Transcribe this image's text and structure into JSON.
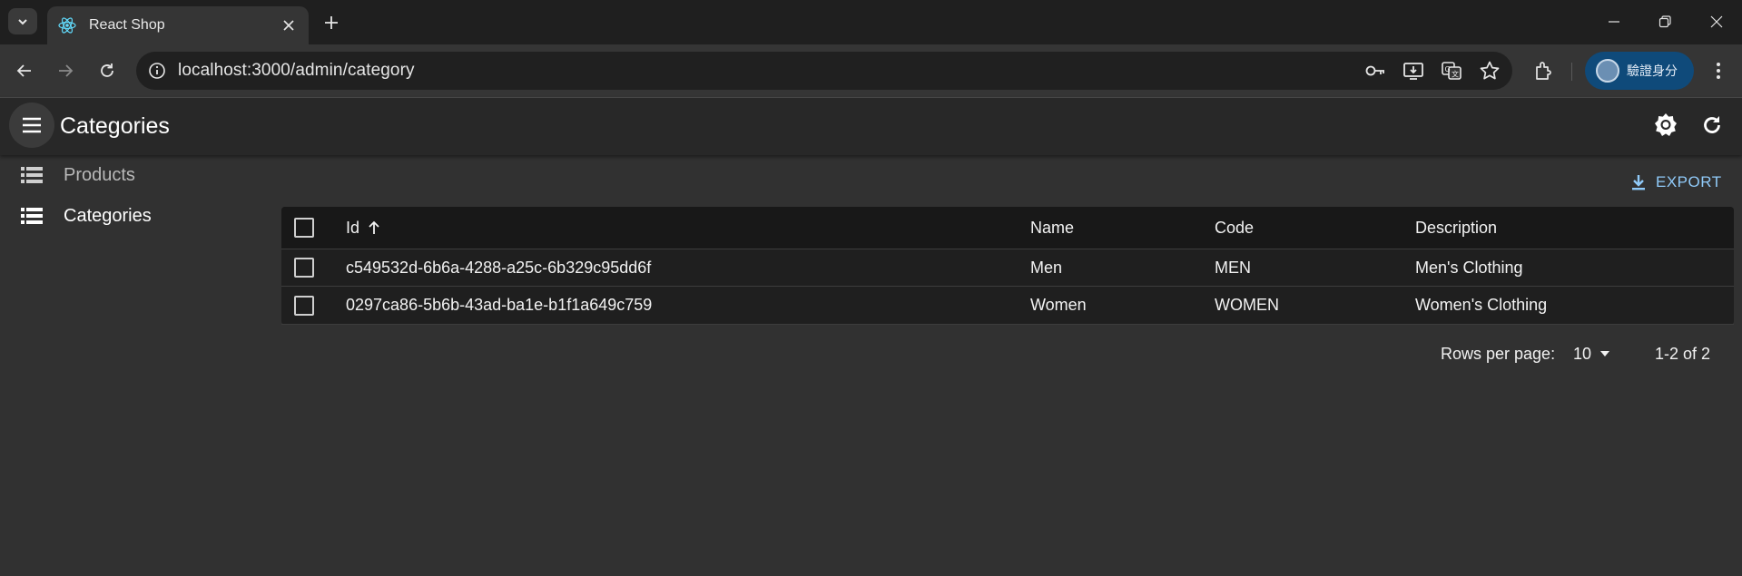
{
  "browser": {
    "tab_title": "React Shop",
    "url": "localhost:3000/admin/category",
    "profile_label": "驗證身分"
  },
  "app": {
    "page_title": "Categories",
    "export_label": "EXPORT",
    "sidebar": {
      "items": [
        {
          "label": "Products",
          "icon": "list-icon",
          "active": false
        },
        {
          "label": "Categories",
          "icon": "list-icon",
          "active": true
        }
      ]
    },
    "grid": {
      "columns": [
        {
          "label": "Id",
          "sort": "asc"
        },
        {
          "label": "Name"
        },
        {
          "label": "Code"
        },
        {
          "label": "Description"
        }
      ],
      "rows": [
        {
          "id": "c549532d-6b6a-4288-a25c-6b329c95dd6f",
          "name": "Men",
          "code": "MEN",
          "description": "Men's Clothing"
        },
        {
          "id": "0297ca86-5b6b-43ad-ba1e-b1f1a649c759",
          "name": "Women",
          "code": "WOMEN",
          "description": "Women's Clothing"
        }
      ]
    },
    "pagination": {
      "rows_per_page_label": "Rows per page:",
      "rows_per_page": "10",
      "range": "1-2 of 2"
    }
  },
  "colors": {
    "accent": "#90caf9",
    "profile_bg": "#0f4a7a"
  }
}
